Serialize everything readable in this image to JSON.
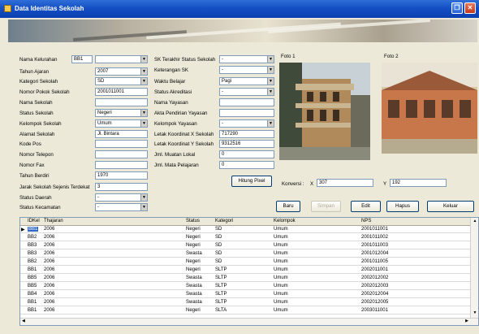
{
  "window": {
    "title": "Data Identitas Sekolah"
  },
  "form_left": [
    {
      "label": "Nama Kelurahan",
      "code": "BB1",
      "value": ""
    },
    {
      "label": "Tahun Ajaran",
      "value": "2007"
    },
    {
      "label": "Kategori Sekolah",
      "value": "SD"
    },
    {
      "label": "Nomor Pokok Sekolah",
      "value": "2001011001"
    },
    {
      "label": "Nama Sekolah",
      "value": ""
    },
    {
      "label": "Status Sekolah",
      "value": "Negeri"
    },
    {
      "label": "Kelompok Sekolah",
      "value": "Umum"
    },
    {
      "label": "Alamat Sekolah",
      "value": "Jl. Bintara"
    },
    {
      "label": "Kode Pos",
      "value": ""
    },
    {
      "label": "Nomor Telepon",
      "value": ""
    },
    {
      "label": "Nomor Fax",
      "value": ""
    },
    {
      "label": "Tahun Berdiri",
      "value": "1970"
    },
    {
      "label": "Jarak Sekolah Sejenis Terdekat",
      "value": "3"
    },
    {
      "label": "Status Daerah",
      "value": "-"
    },
    {
      "label": "Status Kecamatan",
      "value": "-"
    }
  ],
  "form_mid": [
    {
      "label": "SK Terakhir Status Sekolah",
      "value": "-"
    },
    {
      "label": "Keterangan SK",
      "value": "-"
    },
    {
      "label": "Waktu Belajar",
      "value": "Pagi"
    },
    {
      "label": "Status Akreditasi",
      "value": "-"
    },
    {
      "label": "Nama Yayasan",
      "value": ""
    },
    {
      "label": "Akta Pendirian Yayasan",
      "value": ""
    },
    {
      "label": "Kelompok Yayasan",
      "value": "-"
    },
    {
      "label": "Letak Koordinat X Sekolah",
      "value": "717290"
    },
    {
      "label": "Letak Koordinat Y Sekolah",
      "value": "9312516"
    },
    {
      "label": "Jml. Muatan Lokal",
      "value": "0"
    },
    {
      "label": "Jml. Mata Pelajaran",
      "value": "0"
    }
  ],
  "photos": {
    "foto1_label": "Foto 1",
    "foto2_label": "Foto 2"
  },
  "buttons": {
    "hitung": "Hitung Pixel",
    "baru": "Baru",
    "simpan": "Simpan",
    "edit": "Edit",
    "hapus": "Hapus",
    "keluar": "Keluar"
  },
  "konversi": {
    "label": "Konversi :",
    "x_label": "X",
    "x_value": "307",
    "y_label": "Y",
    "y_value": "192"
  },
  "grid": {
    "columns": [
      "IDKel",
      "Thajaran",
      "Status",
      "Kategori",
      "Kelompok",
      "NPS"
    ],
    "rows": [
      [
        "BB1",
        "2006",
        "Negeri",
        "SD",
        "Umum",
        "2001011001"
      ],
      [
        "BB2",
        "2006",
        "Negeri",
        "SD",
        "Umum",
        "2001011002"
      ],
      [
        "BB3",
        "2006",
        "Negeri",
        "SD",
        "Umum",
        "2001011003"
      ],
      [
        "BB3",
        "2006",
        "Swasta",
        "SD",
        "Umum",
        "2001012004"
      ],
      [
        "BB2",
        "2006",
        "Negeri",
        "SD",
        "Umum",
        "2001011005"
      ],
      [
        "BB1",
        "2006",
        "Negeri",
        "SLTP",
        "Umum",
        "2002011001"
      ],
      [
        "BB5",
        "2006",
        "Swasta",
        "SLTP",
        "Umum",
        "2002012002"
      ],
      [
        "BB5",
        "2006",
        "Swasta",
        "SLTP",
        "Umum",
        "2002012003"
      ],
      [
        "BB4",
        "2006",
        "Swasta",
        "SLTP",
        "Umum",
        "2002012004"
      ],
      [
        "BB1",
        "2006",
        "Swasta",
        "SLTP",
        "Umum",
        "2002012005"
      ],
      [
        "BB1",
        "2006",
        "Negeri",
        "SLTA",
        "Umum",
        "2003011001"
      ]
    ]
  },
  "colors": {
    "titlebar": "#1450c4",
    "selected_cell": "#316ac5"
  }
}
